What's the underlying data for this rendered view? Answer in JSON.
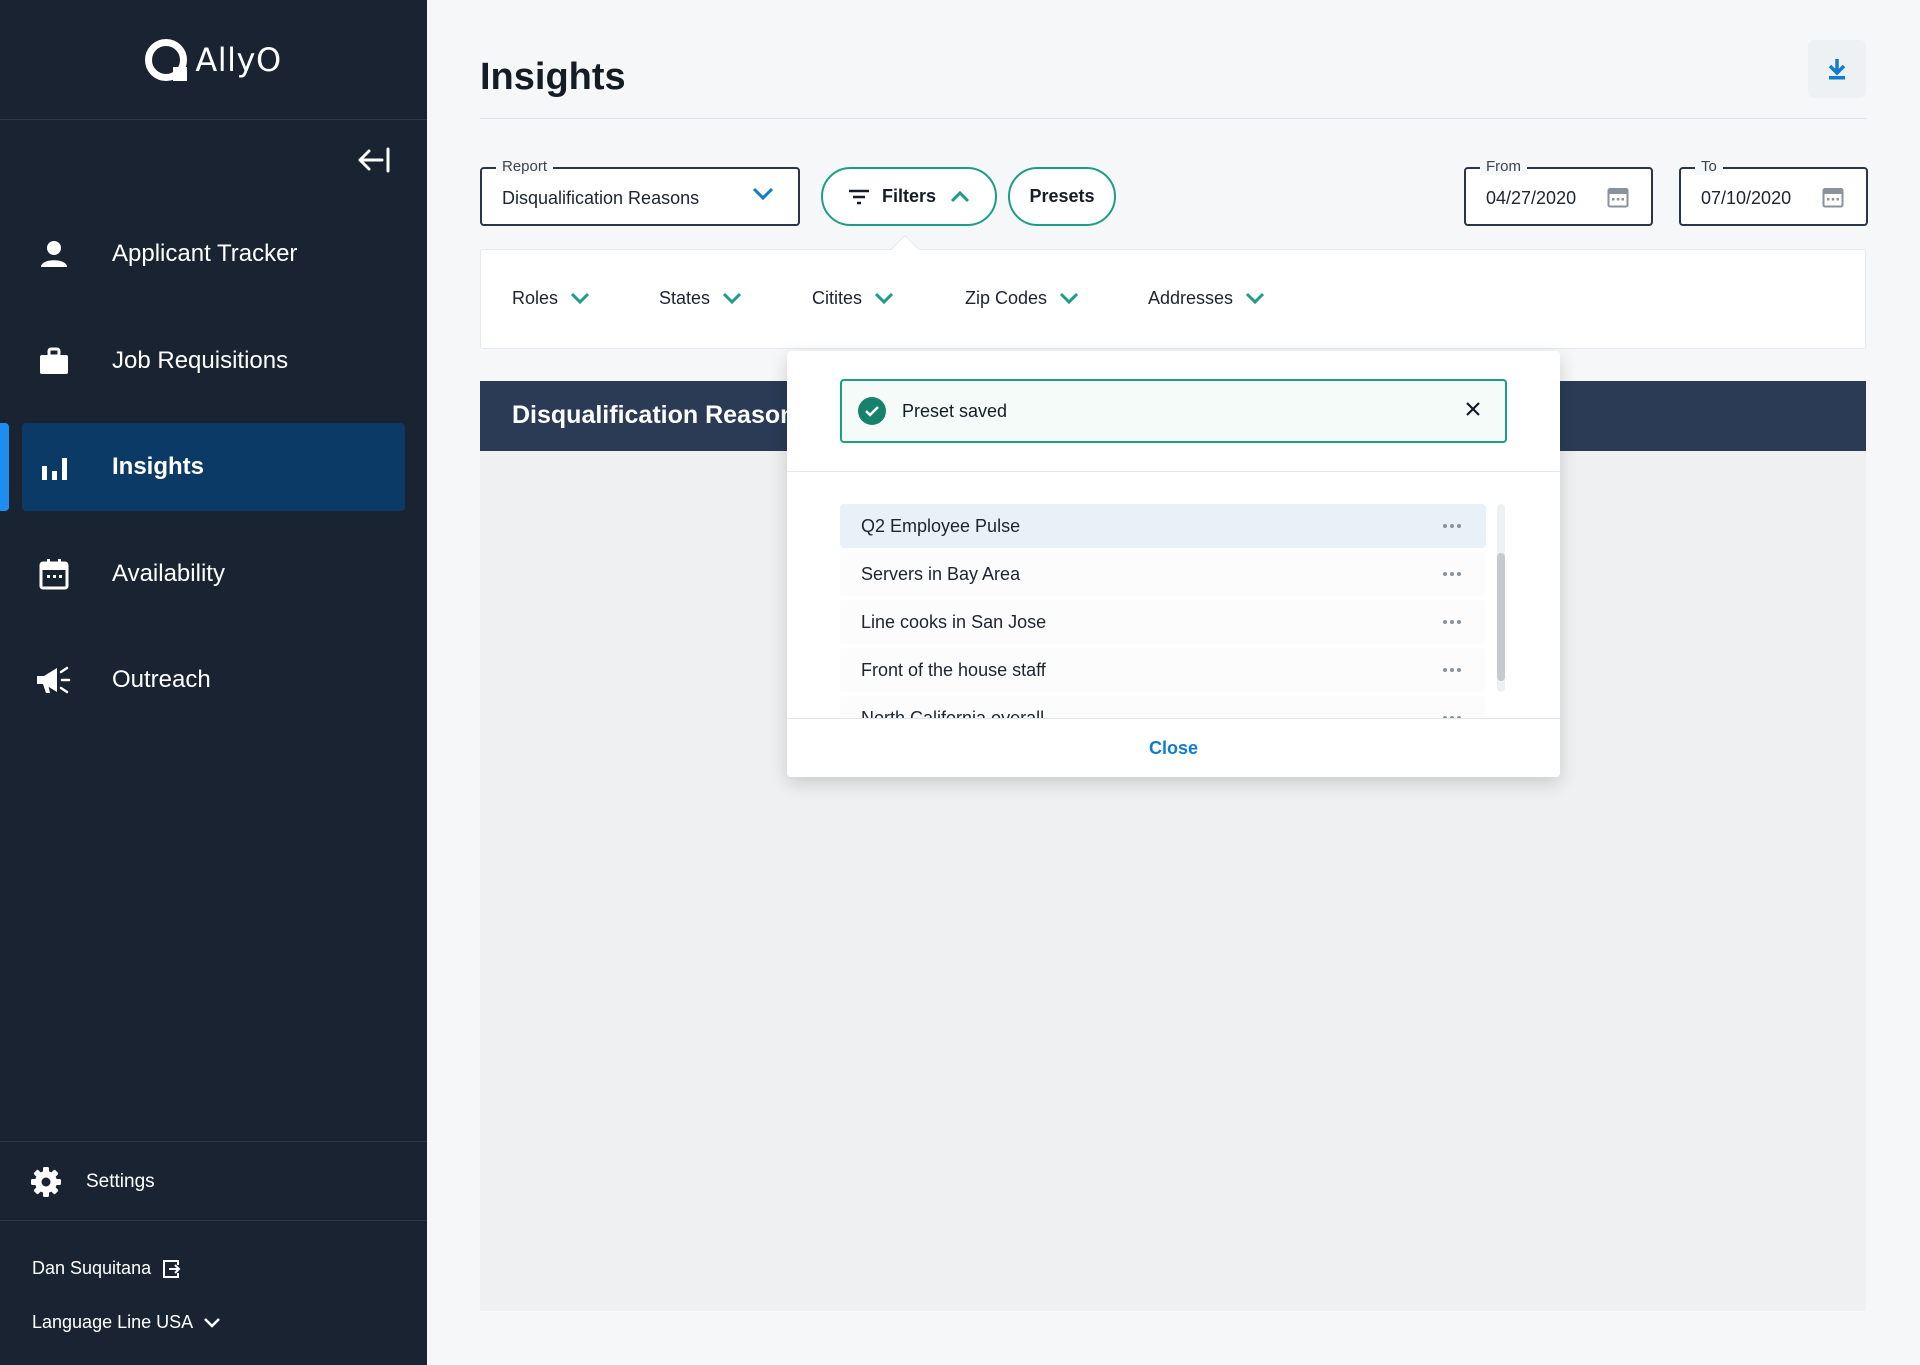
{
  "brand": {
    "name": "AllyO"
  },
  "sidebar": {
    "items": [
      {
        "label": "Applicant Tracker",
        "icon": "person-icon"
      },
      {
        "label": "Job Requisitions",
        "icon": "briefcase-icon"
      },
      {
        "label": "Insights",
        "icon": "bar-chart-icon",
        "active": true
      },
      {
        "label": "Availability",
        "icon": "calendar-icon"
      },
      {
        "label": "Outreach",
        "icon": "megaphone-icon"
      }
    ],
    "settings_label": "Settings",
    "user_name": "Dan Suquitana",
    "org_name": "Language Line USA"
  },
  "header": {
    "title": "Insights"
  },
  "controls": {
    "report_label": "Report",
    "report_value": "Disqualification Reasons",
    "filters_label": "Filters",
    "presets_label": "Presets",
    "from_label": "From",
    "from_value": "04/27/2020",
    "to_label": "To",
    "to_value": "07/10/2020"
  },
  "filters": [
    "Roles",
    "States",
    "Citites",
    "Zip Codes",
    "Addresses"
  ],
  "report": {
    "title": "Disqualification Reasons"
  },
  "popover": {
    "toast": "Preset saved",
    "presets": [
      "Q2 Employee Pulse",
      "Servers in Bay Area",
      "Line cooks in San Jose",
      "Front of the house staff",
      "North California overall"
    ],
    "close_label": "Close"
  },
  "colors": {
    "sidebar_bg": "#1a2332",
    "accent_teal": "#1c9e84",
    "accent_blue": "#0f7ccf",
    "active_nav": "#0b3a66",
    "report_header": "#2b3b55"
  }
}
